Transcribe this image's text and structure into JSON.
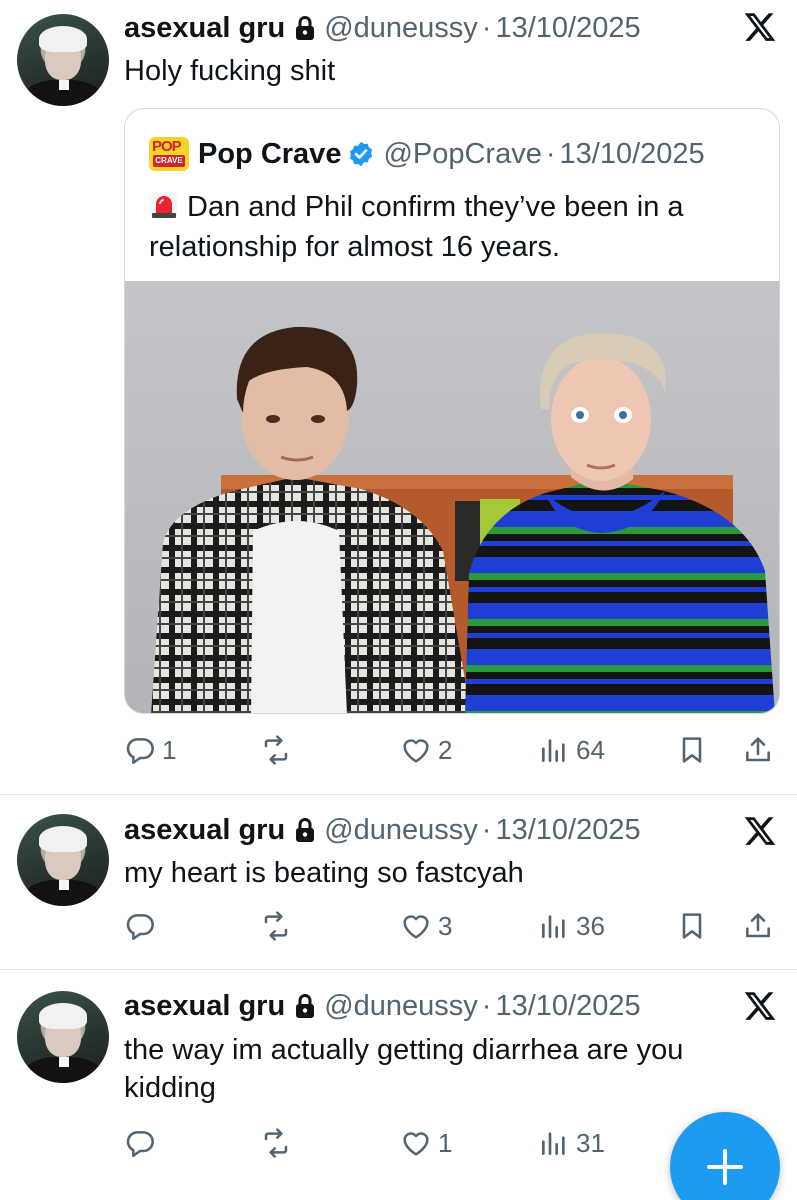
{
  "tweets": [
    {
      "name": "asexual gru",
      "handle": "@duneussy",
      "sep": "·",
      "date": "13/10/2025",
      "text": "Holy fucking shit",
      "quote": {
        "name": "Pop Crave",
        "handle": "@PopCrave",
        "sep": "·",
        "date": "13/10/2025",
        "logo_top": "POP",
        "logo_bottom": "CRAVE",
        "text": "Dan and Phil confirm they’ve been in a relationship for almost 16 years."
      },
      "replies": "1",
      "reposts": "",
      "likes": "2",
      "views": "64"
    },
    {
      "name": "asexual gru",
      "handle": "@duneussy",
      "sep": "·",
      "date": "13/10/2025",
      "text": "my heart is beating so fastcyah",
      "replies": "",
      "reposts": "",
      "likes": "3",
      "views": "36"
    },
    {
      "name": "asexual gru",
      "handle": "@duneussy",
      "sep": "·",
      "date": "13/10/2025",
      "text": "the way im actually getting diarrhea are you kidding",
      "replies": "",
      "reposts": "",
      "likes": "1",
      "views": "31"
    }
  ],
  "icons": {
    "reply": "reply-icon",
    "repost": "repost-icon",
    "like": "heart-icon",
    "views": "views-icon",
    "bookmark": "bookmark-icon",
    "share": "share-icon",
    "platform": "x-logo-icon",
    "protected": "lock-icon",
    "verified": "verified-badge-icon",
    "compose": "plus-icon"
  },
  "colors": {
    "accent": "#1d9bf0",
    "secondary_text": "#536471",
    "primary_text": "#0f1419",
    "border": "#cfd9de"
  }
}
